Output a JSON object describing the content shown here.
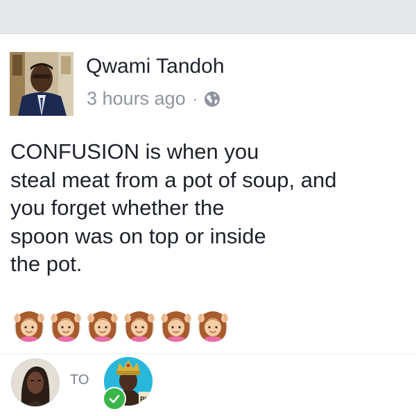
{
  "post": {
    "author_name": "Qwami Tandoh",
    "timestamp": "3 hours ago",
    "separator": "·",
    "privacy_icon": "globe-icon",
    "lines": [
      "CONFUSION is when you",
      "steal meat from a pot of soup, and",
      "you forget whether the",
      "spoon was on top or inside",
      "the pot."
    ],
    "emoji_icon": "woman-gesturing-ok-emoji",
    "emoji_count": 6
  },
  "footer": {
    "to_label": "TO",
    "recipient_badge_icon": "check-icon",
    "recipient_sign_text": "PI"
  },
  "colors": {
    "top_bar": "#e6e8ec",
    "text": "#1d2129",
    "meta": "#90949c",
    "check_badge": "#3ab54a",
    "recipient_bg": "#29b8dc"
  }
}
